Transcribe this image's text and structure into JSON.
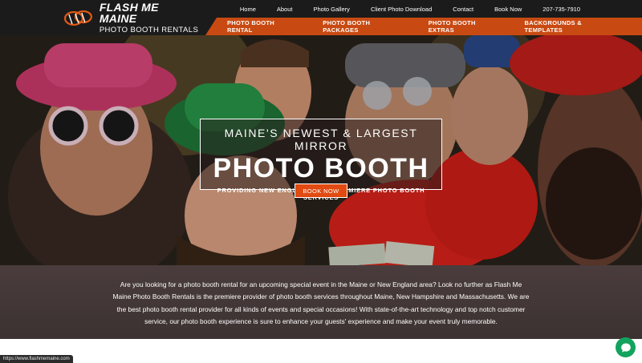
{
  "header": {
    "logo_title": "FLASH ME MAINE",
    "logo_subtitle": "PHOTO BOOTH RENTALS",
    "top_nav": [
      "Home",
      "About",
      "Photo Gallery",
      "Client Photo Download",
      "Contact",
      "Book Now",
      "207-735-7910"
    ],
    "service_nav": [
      "PHOTO BOOTH RENTAL",
      "PHOTO BOOTH PACKAGES",
      "PHOTO BOOTH EXTRAS",
      "BACKGROUNDS & TEMPLATES"
    ]
  },
  "hero": {
    "line1": "MAINE'S NEWEST & LARGEST MIRROR",
    "line2": "PHOTO BOOTH",
    "line3": "PROVIDING NEW ENGLAND WITH PREMIERE PHOTO BOOTH SERVICES",
    "cta": "BOOK NOW"
  },
  "intro": {
    "text": "Are you looking for a photo booth rental for an upcoming special event in the Maine or New England area? Look no further as Flash Me Maine Photo Booth Rentals is the premiere provider of photo booth services throughout Maine, New Hampshire and Massachusetts. We are the best photo booth rental provider for all kinds of events and special occasions! With state-of-the-art technology and top notch customer service, our photo booth experience is sure to enhance your guests' experience and make your event truly memorable."
  },
  "status": {
    "url": "https://www.flashmemaine.com"
  },
  "colors": {
    "accent": "#c84a12",
    "button": "#e14a10",
    "header_bg": "#1b1b1b",
    "chat": "#12a35e"
  },
  "icons": {
    "logo": "flash-bulb-icon",
    "chat": "chat-icon"
  }
}
